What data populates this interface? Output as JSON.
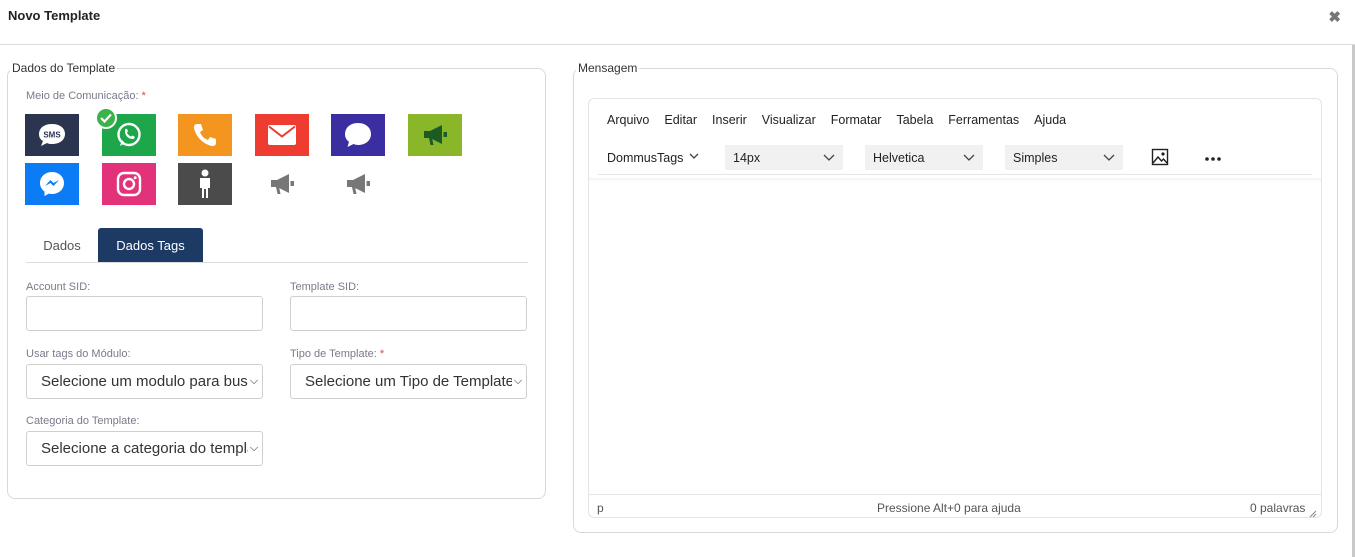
{
  "modal": {
    "title": "Novo Template",
    "close_glyph": "✖"
  },
  "left": {
    "legend": "Dados do Template",
    "channels_label": "Meio de Comunicação:",
    "required_mark": "*",
    "channels": [
      {
        "name": "sms",
        "icon": "sms-icon",
        "color": "#2b3550",
        "text": "SMS"
      },
      {
        "name": "whatsapp",
        "icon": "whatsapp-icon",
        "color": "#1ea64a",
        "selected": true
      },
      {
        "name": "phone",
        "icon": "phone-icon",
        "color": "#f3951f"
      },
      {
        "name": "email",
        "icon": "email-icon",
        "color": "#ee3c31"
      },
      {
        "name": "chat",
        "icon": "chat-bubble-icon",
        "color": "#3b2ea0"
      },
      {
        "name": "campaign",
        "icon": "megaphone-icon",
        "color": "#8ab62a"
      },
      {
        "name": "messenger",
        "icon": "messenger-icon",
        "color": "#0b7cf5"
      },
      {
        "name": "instagram",
        "icon": "instagram-icon",
        "color": "#e2327a"
      },
      {
        "name": "person",
        "icon": "person-icon",
        "color": "#4b4b4b"
      },
      {
        "name": "megaphone-gray-1",
        "icon": "megaphone-icon",
        "color": "#777777"
      },
      {
        "name": "megaphone-gray-2",
        "icon": "megaphone-icon",
        "color": "#777777"
      }
    ],
    "tabs": [
      {
        "label": "Dados",
        "active": false
      },
      {
        "label": "Dados Tags",
        "active": true
      }
    ],
    "fields": {
      "account_sid": {
        "label": "Account SID:",
        "value": ""
      },
      "template_sid": {
        "label": "Template SID:",
        "value": ""
      },
      "module_tags": {
        "label": "Usar tags do Módulo:",
        "value": "Selecione um modulo para buscar"
      },
      "template_type": {
        "label": "Tipo de Template:",
        "value": "Selecione um Tipo de Template"
      },
      "template_category": {
        "label": "Categoria do Template:",
        "value": "Selecione a categoria do template"
      }
    }
  },
  "right": {
    "legend": "Mensagem",
    "menu": [
      "Arquivo",
      "Editar",
      "Inserir",
      "Visualizar",
      "Formatar",
      "Tabela",
      "Ferramentas",
      "Ajuda"
    ],
    "toolbar": {
      "tags": "DommusTags",
      "font_size": "14px",
      "font_family": "Helvetica",
      "block_format": "Simples",
      "image_icon": "image-icon",
      "more_icon": "more-horizontal-icon"
    },
    "status": {
      "path": "p",
      "help": "Pressione Alt+0 para ajuda",
      "words": "0 palavras"
    }
  }
}
